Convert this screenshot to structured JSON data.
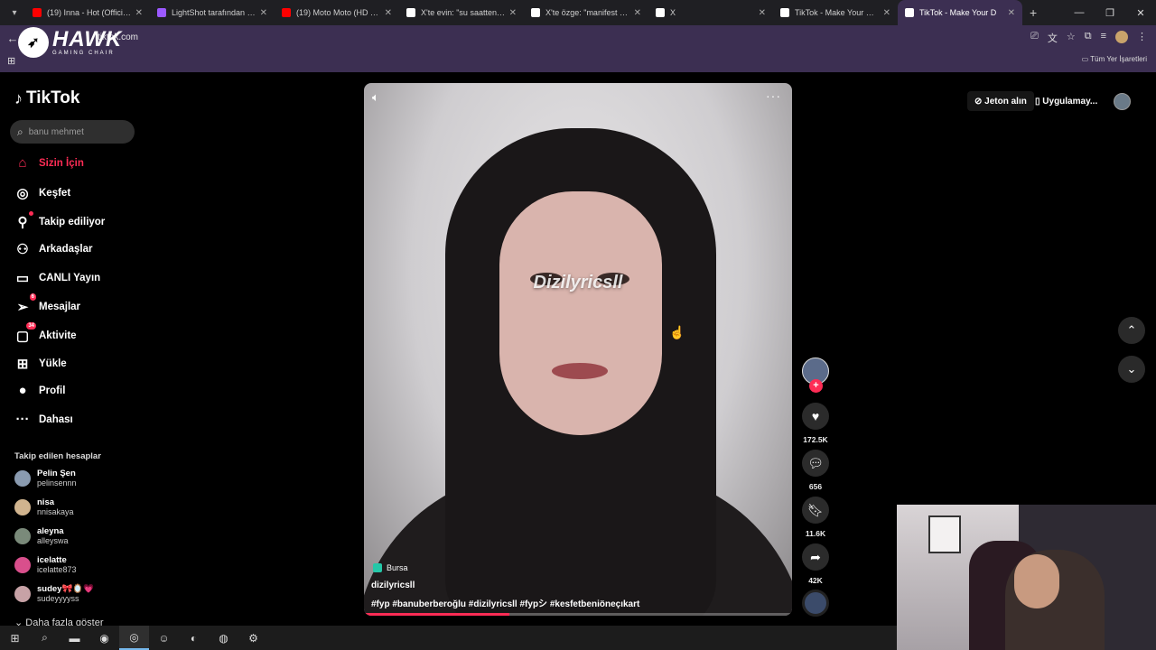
{
  "browser": {
    "tabs": [
      {
        "label": "(19) Inna - Hot (Official V",
        "color": "#ff0000",
        "active": false
      },
      {
        "label": "LightShot tarafından Ekra",
        "color": "#9b59ff",
        "active": false
      },
      {
        "label": "(19) Moto Moto (HD Türk",
        "color": "#ff0000",
        "active": false
      },
      {
        "label": "X'te evin: \"su saatten son",
        "color": "#ffffff",
        "active": false
      },
      {
        "label": "X'te özge: \"manifest kızla",
        "color": "#ffffff",
        "active": false
      },
      {
        "label": "X",
        "color": "#ffffff",
        "active": false
      },
      {
        "label": "TikTok - Make Your Day",
        "color": "#ffffff",
        "active": false
      },
      {
        "label": "TikTok - Make Your D",
        "color": "#ffffff",
        "active": true
      }
    ],
    "url": "tiktok.com",
    "bookmarks_label": "Tüm Yer İşaretleri",
    "overlay_logo": {
      "big": "HAWK",
      "small": "GAMING CHAIR"
    }
  },
  "sidebar": {
    "logo": "TikTok",
    "search_placeholder": "banu mehmet",
    "nav": [
      {
        "label": "Sizin İçin",
        "icon": "home-icon",
        "glyph": "⌂",
        "active": true,
        "badge": ""
      },
      {
        "label": "Keşfet",
        "icon": "compass-icon",
        "glyph": "◎",
        "active": false,
        "badge": ""
      },
      {
        "label": "Takip ediliyor",
        "icon": "following-icon",
        "glyph": "⚲",
        "active": false,
        "badge": "dot"
      },
      {
        "label": "Arkadaşlar",
        "icon": "friends-icon",
        "glyph": "⚇",
        "active": false,
        "badge": ""
      },
      {
        "label": "CANLI Yayın",
        "icon": "live-icon",
        "glyph": "▭",
        "active": false,
        "badge": ""
      },
      {
        "label": "Mesajlar",
        "icon": "messages-icon",
        "glyph": "➢",
        "active": false,
        "badge": "6"
      },
      {
        "label": "Aktivite",
        "icon": "activity-icon",
        "glyph": "▢",
        "active": false,
        "badge": "34"
      },
      {
        "label": "Yükle",
        "icon": "upload-icon",
        "glyph": "⊞",
        "active": false,
        "badge": ""
      },
      {
        "label": "Profil",
        "icon": "profile-icon",
        "glyph": "●",
        "active": false,
        "badge": ""
      },
      {
        "label": "Dahası",
        "icon": "more-icon",
        "glyph": "···",
        "active": false,
        "badge": ""
      }
    ],
    "followed_title": "Takip edilen hesaplar",
    "followed": [
      {
        "name": "Pelin Şen",
        "user": "pelinsennn",
        "color": "#8a9bb0"
      },
      {
        "name": "nisa",
        "user": "nnisakaya",
        "color": "#d1b48f"
      },
      {
        "name": "aleyna",
        "user": "alleyswa",
        "color": "#7a8a7a"
      },
      {
        "name": "icelatte",
        "user": "icelatte873",
        "color": "#d94f8c"
      },
      {
        "name": "sudey🎀🪞💗",
        "user": "sudeyyyyss",
        "color": "#c7a2a6"
      }
    ],
    "more_following": "Daha fazla göster"
  },
  "video": {
    "watermark": "Dizilyricsll",
    "location": "Bursa",
    "author": "dizilyricsll",
    "caption": "#fyp #banuberberoğlu #dizilyricsll #fypシ #kesfetbeniöneçıkart",
    "progress": 0.34
  },
  "actions": {
    "likes": "172.5K",
    "comments": "656",
    "saves": "11.6K",
    "shares": "42K"
  },
  "topright": {
    "coins": "Jeton alın",
    "app": "Uygulamay..."
  },
  "taskbar": [
    "windows-icon",
    "search-icon",
    "folder-icon",
    "app-icon",
    "chrome-icon",
    "discord-icon",
    "obs-icon",
    "spotify-icon",
    "steam-icon"
  ]
}
